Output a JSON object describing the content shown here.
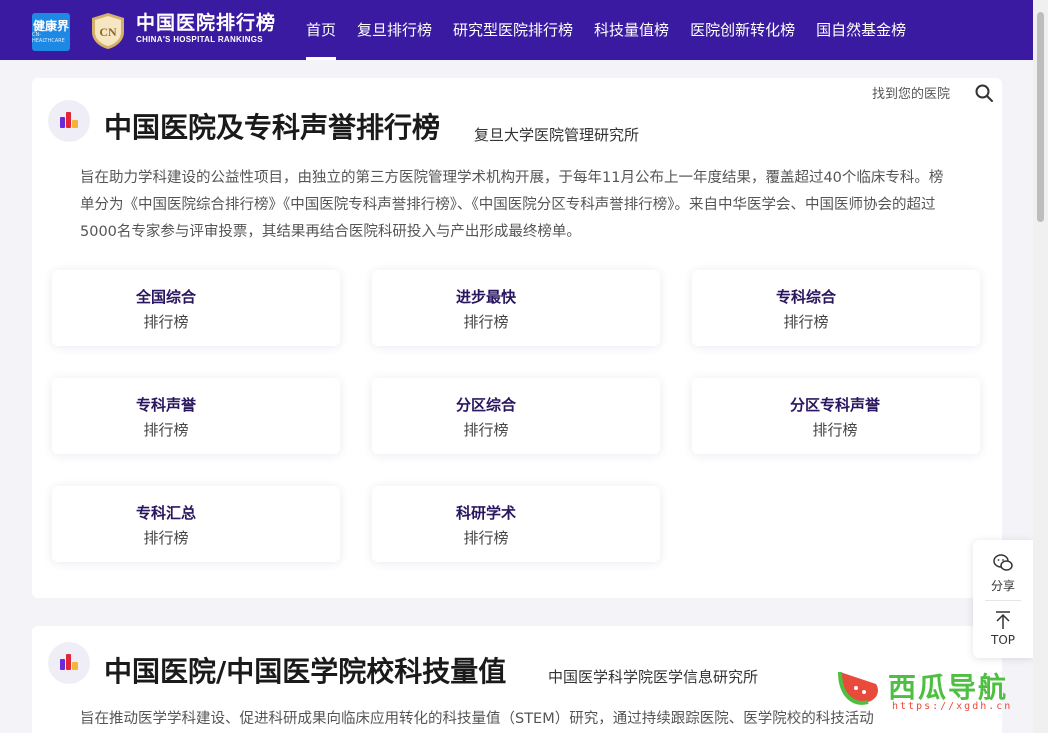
{
  "brand": {
    "partner_logo_label": "健康界",
    "partner_logo_sub": "CN-HEALTHCARE",
    "emblem_text": "CN",
    "title_zh": "中国医院排行榜",
    "title_en": "CHINA'S HOSPITAL RANKINGS"
  },
  "nav": {
    "items": [
      "首页",
      "复旦排行榜",
      "研究型医院排行榜",
      "科技量值榜",
      "医院创新转化榜",
      "国自然基金榜"
    ],
    "active_index": 0
  },
  "search": {
    "label": "找到您的医院"
  },
  "section1": {
    "title": "中国医院及专科声誉排行榜",
    "subtitle": "复旦大学医院管理研究所",
    "desc": "旨在助力学科建设的公益性项目，由独立的第三方医院管理学术机构开展，于每年11月公布上一年度结果，覆盖超过40个临床专科。榜单分为《中国医院综合排行榜》《中国医院专科声誉排行榜》、《中国医院分区专科声誉排行榜》。来自中华医学会、中国医师协会的超过5000名专家参与评审投票，其结果再结合医院科研投入与产出形成最终榜单。",
    "cards": [
      {
        "title": "全国综合",
        "sub": "排行榜"
      },
      {
        "title": "进步最快",
        "sub": "排行榜"
      },
      {
        "title": "专科综合",
        "sub": "排行榜"
      },
      {
        "title": "专科声誉",
        "sub": "排行榜"
      },
      {
        "title": "分区综合",
        "sub": "排行榜"
      },
      {
        "title": "分区专科声誉",
        "sub": "排行榜"
      },
      {
        "title": "专科汇总",
        "sub": "排行榜"
      },
      {
        "title": "科研学术",
        "sub": "排行榜"
      }
    ]
  },
  "section2": {
    "title": "中国医院/中国医学院校科技量值",
    "subtitle": "中国医学科学院医学信息研究所",
    "desc": "旨在推动医学学科建设、促进科研成果向临床应用转化的科技量值（STEM）研究，通过持续跟踪医院、医学院校的科技活动"
  },
  "float": {
    "share_label": "分享",
    "top_label": "TOP"
  },
  "watermark": {
    "name": "西瓜导航",
    "url": "https://xgdh.cn"
  },
  "colors": {
    "nav_bg": "#3a1aa0",
    "card_title": "#2a1660",
    "accent_green": "#4fbf42"
  }
}
